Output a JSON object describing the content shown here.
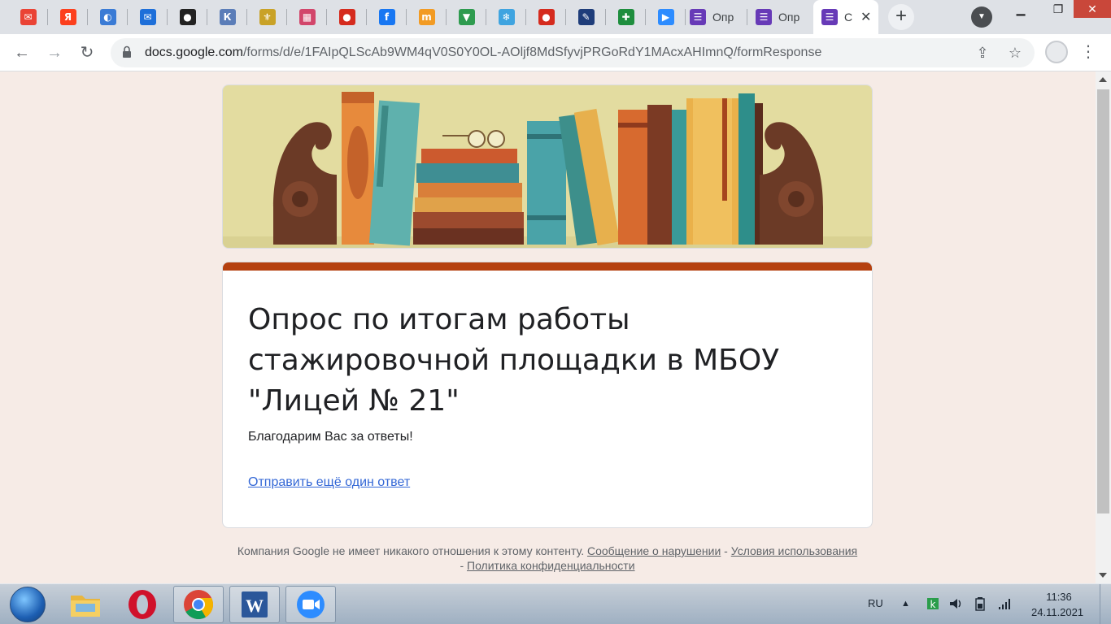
{
  "browser": {
    "tabs": [
      {
        "icon": "gmail-icon",
        "color": "#ea4335",
        "glyph": "✉"
      },
      {
        "icon": "yandex-icon",
        "color": "#fc3f1d",
        "glyph": "Я"
      },
      {
        "icon": "site-icon",
        "color": "#3a7bd5",
        "glyph": "◐"
      },
      {
        "icon": "mail-icon",
        "color": "#1e6fd9",
        "glyph": "✉"
      },
      {
        "icon": "site-dark-icon",
        "color": "#222222",
        "glyph": "●"
      },
      {
        "icon": "ikro-icon",
        "color": "#5b7db8",
        "glyph": "К"
      },
      {
        "icon": "emblem-icon",
        "color": "#c9a227",
        "glyph": "⚜"
      },
      {
        "icon": "picture-icon",
        "color": "#d2466b",
        "glyph": "▦"
      },
      {
        "icon": "russia-flag-icon",
        "color": "#d52b1e",
        "glyph": "●"
      },
      {
        "icon": "facebook-icon",
        "color": "#1877f2",
        "glyph": "f"
      },
      {
        "icon": "mn-icon",
        "color": "#f29b24",
        "glyph": "m"
      },
      {
        "icon": "triangle-icon",
        "color": "#2e9b4f",
        "glyph": "▼"
      },
      {
        "icon": "snowflake-icon",
        "color": "#3fa4e0",
        "glyph": "❄"
      },
      {
        "icon": "russia-flag-icon",
        "color": "#d52b1e",
        "glyph": "●"
      },
      {
        "icon": "edit-icon",
        "color": "#1f3d7a",
        "glyph": "✎"
      },
      {
        "icon": "sheets-icon",
        "color": "#1e8e3e",
        "glyph": "✚"
      },
      {
        "icon": "zoom-icon",
        "color": "#2d8cff",
        "glyph": "▶"
      }
    ],
    "wide_tabs": [
      {
        "title": "Опр",
        "icon": "forms-icon"
      },
      {
        "title": "Опр",
        "icon": "forms-icon"
      },
      {
        "title": "С",
        "icon": "forms-icon"
      }
    ],
    "url_host": "docs.google.com",
    "url_path": "/forms/d/e/1FAIpQLScAb9WM4qV0S0Y0OL-AOljf8MdSfyvjPRGoRdY1MAcxAHImnQ/formResponse"
  },
  "form": {
    "title": "Опрос по итогам работы стажировочной площадки в МБОУ \"Лицей № 21\"",
    "thanks": "Благодарим Вас за ответы!",
    "again_link": "Отправить ещё один ответ",
    "accent": "#b5400f"
  },
  "footer": {
    "text": "Компания Google не имеет никакого отношения к этому контенту.",
    "report": "Сообщение о нарушении",
    "sep": "-",
    "terms": "Условия использования",
    "privacy": "Политика конфиденциальности"
  },
  "taskbar": {
    "lang": "RU",
    "time": "11:36",
    "date": "24.11.2021"
  }
}
